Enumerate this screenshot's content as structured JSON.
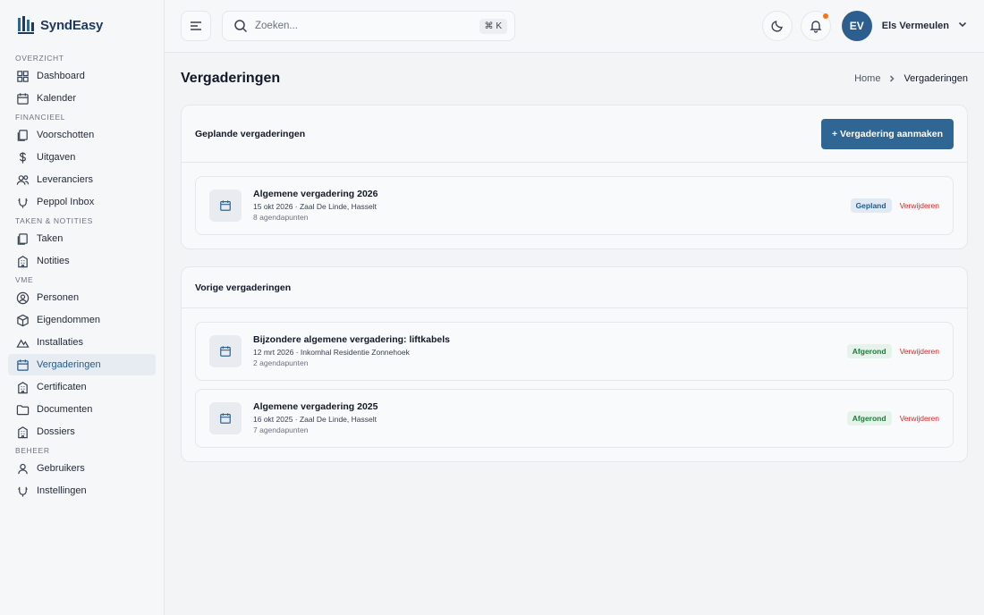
{
  "app": {
    "name": "SyndEasy"
  },
  "colors": {
    "brand": "#1e3a5f",
    "primary": "#2f6694",
    "danger": "#dc2626",
    "success": "#1c7a3e",
    "notification": "#f97316"
  },
  "sidebar": {
    "sections": [
      {
        "title": "OVERZICHT",
        "items": [
          {
            "label": "Dashboard",
            "icon": "dashboard-icon"
          },
          {
            "label": "Kalender",
            "icon": "calendar-icon"
          }
        ]
      },
      {
        "title": "FINANCIEEL",
        "items": [
          {
            "label": "Voorschotten",
            "icon": "copy-icon"
          },
          {
            "label": "Uitgaven",
            "icon": "dollar-icon"
          },
          {
            "label": "Leveranciers",
            "icon": "users-icon"
          },
          {
            "label": "Peppol Inbox",
            "icon": "shield-icon"
          }
        ]
      },
      {
        "title": "TAKEN & NOTITIES",
        "items": [
          {
            "label": "Taken",
            "icon": "copy-icon"
          },
          {
            "label": "Notities",
            "icon": "building-icon"
          }
        ]
      },
      {
        "title": "VME",
        "items": [
          {
            "label": "Personen",
            "icon": "user-circle-icon"
          },
          {
            "label": "Eigendommen",
            "icon": "box-icon"
          },
          {
            "label": "Installaties",
            "icon": "activity-icon"
          },
          {
            "label": "Vergaderingen",
            "icon": "calendar-icon",
            "active": true
          },
          {
            "label": "Certificaten",
            "icon": "building-icon"
          },
          {
            "label": "Documenten",
            "icon": "folder-icon"
          },
          {
            "label": "Dossiers",
            "icon": "building-icon"
          }
        ]
      },
      {
        "title": "BEHEER",
        "items": [
          {
            "label": "Gebruikers",
            "icon": "user-icon"
          },
          {
            "label": "Instellingen",
            "icon": "shield-icon"
          }
        ]
      }
    ]
  },
  "topbar": {
    "search_placeholder": "Zoeken...",
    "shortcut": "⌘ K",
    "user": {
      "initials": "EV",
      "name": "Els Vermeulen"
    }
  },
  "page": {
    "title": "Vergaderingen",
    "breadcrumb": {
      "home": "Home",
      "current": "Vergaderingen"
    }
  },
  "planned": {
    "title": "Geplande vergaderingen",
    "create_label": "+ Vergadering aanmaken",
    "meetings": [
      {
        "title": "Algemene vergadering 2026",
        "sub": "15 okt 2026 · Zaal De Linde, Hasselt",
        "agenda": "8 agendapunten",
        "status": "Gepland",
        "status_type": "planned",
        "delete": "Verwijderen"
      }
    ]
  },
  "previous": {
    "title": "Vorige vergaderingen",
    "meetings": [
      {
        "title": "Bijzondere algemene vergadering: liftkabels",
        "sub": "12 mrt 2026 · Inkomhal Residentie Zonnehoek",
        "agenda": "2 agendapunten",
        "status": "Afgerond",
        "status_type": "done",
        "delete": "Verwijderen"
      },
      {
        "title": "Algemene vergadering 2025",
        "sub": "16 okt 2025 · Zaal De Linde, Hasselt",
        "agenda": "7 agendapunten",
        "status": "Afgerond",
        "status_type": "done",
        "delete": "Verwijderen"
      }
    ]
  }
}
